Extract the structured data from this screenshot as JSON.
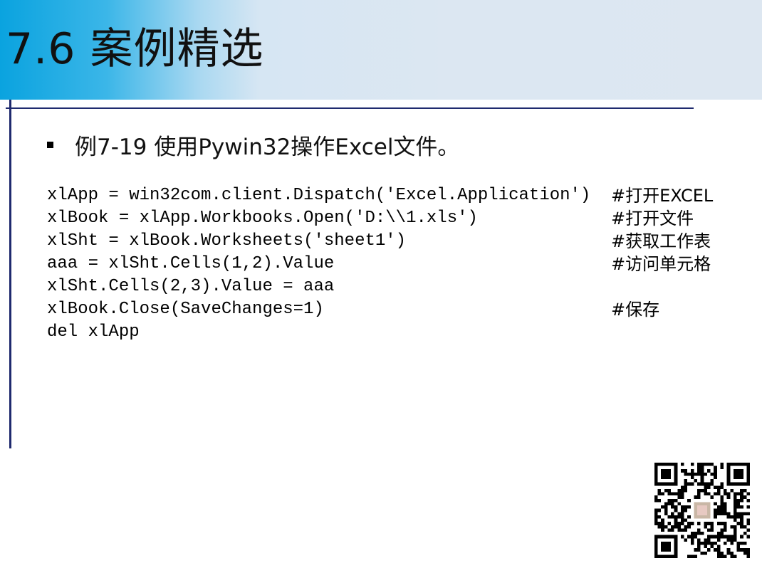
{
  "slide": {
    "title": "7.6 案例精选",
    "bullet": "例7-19  使用Pywin32操作Excel文件。"
  },
  "code": [
    {
      "text": "xlApp = win32com.client.Dispatch('Excel.Application')",
      "comment": "#打开EXCEL"
    },
    {
      "text": "xlBook = xlApp.Workbooks.Open('D:\\\\1.xls')",
      "comment": "#打开文件"
    },
    {
      "text": "xlSht = xlBook.Worksheets('sheet1')",
      "comment": "#获取工作表"
    },
    {
      "text": "aaa = xlSht.Cells(1,2).Value",
      "comment": "#访问单元格"
    },
    {
      "text": "xlSht.Cells(2,3).Value = aaa",
      "comment": ""
    },
    {
      "text": "xlBook.Close(SaveChanges=1)",
      "comment": "#保存"
    },
    {
      "text": "del xlApp",
      "comment": ""
    }
  ],
  "colors": {
    "title_bar_left": "#0aa3df",
    "title_bar_right": "#dde7f1",
    "rule": "#1f2a6e"
  }
}
